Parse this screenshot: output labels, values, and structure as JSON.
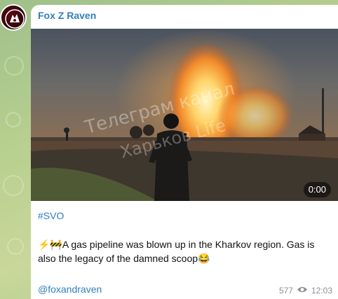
{
  "channel": {
    "name": "Fox Z Raven",
    "avatar_icon": "fox-raven-avatar-icon"
  },
  "video": {
    "duration": "0:00",
    "watermark_line1": "Телеграм канал",
    "watermark_line2": "Харьков Life"
  },
  "post": {
    "hashtag": "#SVO",
    "emoji_lead": "⚡🚧",
    "text": "A gas pipeline was blown up in the Kharkov region. Gas is also the legacy of the damned scoop",
    "emoji_tail": "😂",
    "handle": "@foxandraven",
    "views": "577",
    "time": "12:03"
  },
  "colors": {
    "accent": "#2f7fbf",
    "bubble": "#ffffff",
    "wallpaper": "#b7cf8f"
  }
}
